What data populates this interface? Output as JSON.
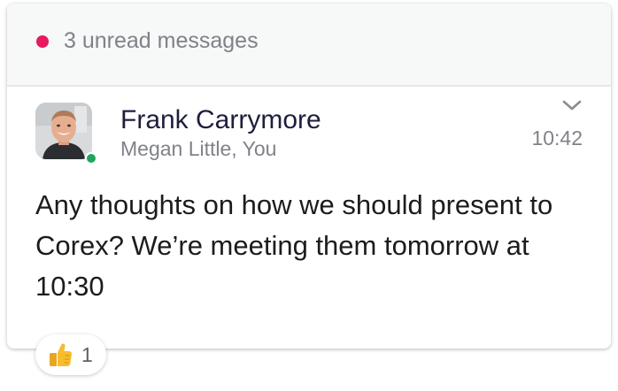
{
  "banner": {
    "unread_text": "3 unread messages"
  },
  "message": {
    "sender": "Frank Carrymore",
    "participants": "Megan Little, You",
    "time": "10:42",
    "body": "Any thoughts on how we should present to Corex? We’re meeting them tomorrow at 10:30",
    "reaction": {
      "emoji": "thumbs-up",
      "count": "1"
    }
  },
  "colors": {
    "unread_dot": "#e8195e",
    "presence_online": "#23a45b",
    "sender_text": "#1f1e3d",
    "muted_text": "#80828a"
  },
  "icons": {
    "expand": "chevron-down-icon",
    "reaction": "thumbs-up-icon"
  }
}
